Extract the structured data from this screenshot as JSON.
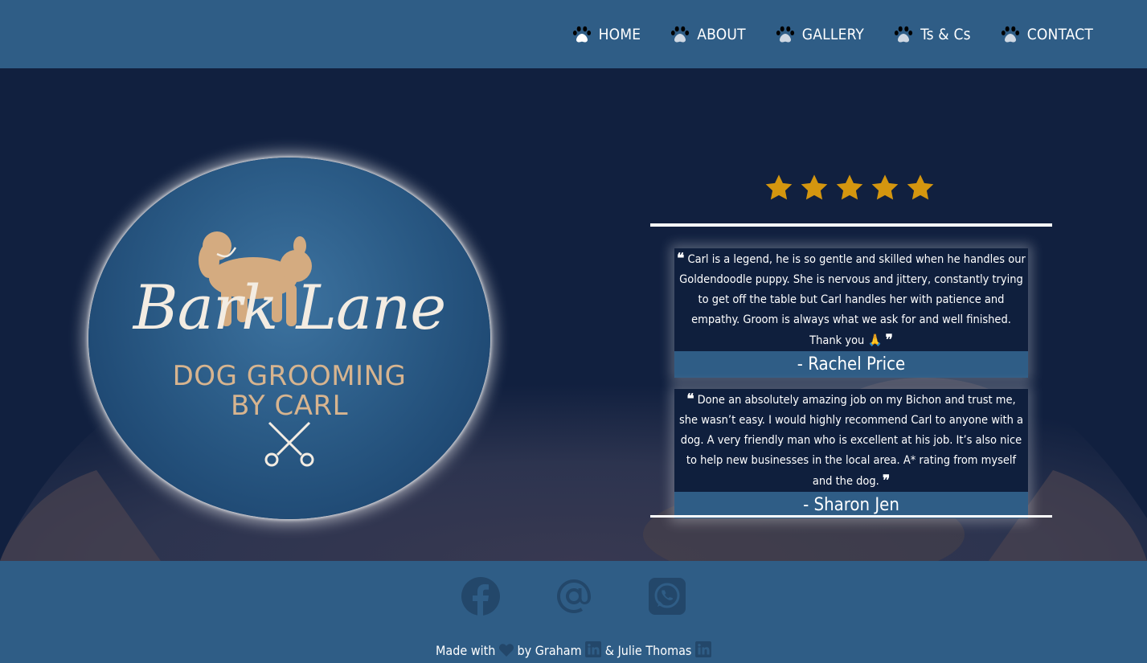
{
  "nav": {
    "items": [
      {
        "label": "HOME"
      },
      {
        "label": "ABOUT"
      },
      {
        "label": "GALLERY"
      },
      {
        "label": "Ts & Cs"
      },
      {
        "label": "CONTACT"
      }
    ]
  },
  "logo": {
    "title": "Bark Lane",
    "subtitle_line1": "DOG GROOMING",
    "subtitle_line2": "BY CARL",
    "icon": "scissors-icon"
  },
  "rating": {
    "stars": 5,
    "max": 5,
    "color": "#d4960f"
  },
  "reviews": [
    {
      "quote": "Carl is a legend, he is so gentle and skilled when he handles our Goldendoodle puppy. She is nervous and jittery, constantly trying to get off the table but Carl handles her with patience and empathy. Groom is always what we ask for and well finished. Thank you 🙏",
      "author": "- Rachel Price"
    },
    {
      "quote": "Done an absolutely amazing job on my Bichon and trust me, she wasn’t easy. I would highly recommend Carl to anyone with a dog. A very friendly man who is excellent at his job. It’s also nice to help new businesses in the local area. A* rating from myself and the dog.",
      "author": "- Sharon Jen"
    }
  ],
  "footer": {
    "social": [
      "facebook-icon",
      "at-sign-icon",
      "whatsapp-icon"
    ],
    "made_with": "Made with",
    "by_1": "by Graham",
    "and": "& Julie Thomas"
  },
  "colors": {
    "primary": "#2f5d86",
    "dark": "#11203f",
    "star": "#d4960f",
    "social_icon": "#23476a"
  }
}
